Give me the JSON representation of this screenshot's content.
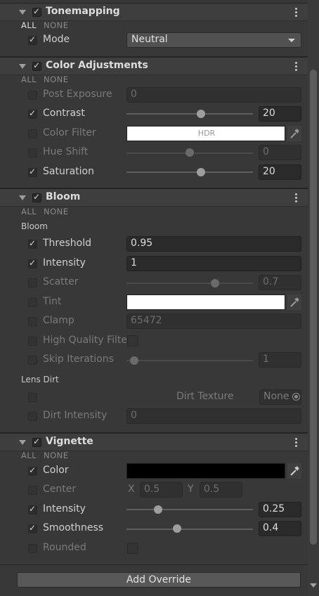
{
  "tonemapping": {
    "title": "Tonemapping",
    "all": "ALL",
    "none": "NONE",
    "mode_label": "Mode",
    "mode_value": "Neutral"
  },
  "color_adjustments": {
    "title": "Color Adjustments",
    "all": "ALL",
    "none": "NONE",
    "post_exposure_label": "Post Exposure",
    "post_exposure_value": "0",
    "contrast_label": "Contrast",
    "contrast_value": "20",
    "contrast_slider": 0.59,
    "color_filter_label": "Color Filter",
    "color_filter_hdr": "HDR",
    "color_filter_color": "#ffffff",
    "hue_shift_label": "Hue Shift",
    "hue_shift_value": "0",
    "hue_shift_slider": 0.5,
    "saturation_label": "Saturation",
    "saturation_value": "20",
    "saturation_slider": 0.59
  },
  "bloom": {
    "title": "Bloom",
    "all": "ALL",
    "none": "NONE",
    "section_bloom": "Bloom",
    "threshold_label": "Threshold",
    "threshold_value": "0.95",
    "intensity_label": "Intensity",
    "intensity_value": "1",
    "scatter_label": "Scatter",
    "scatter_value": "0.7",
    "scatter_slider": 0.7,
    "tint_label": "Tint",
    "tint_color": "#ffffff",
    "clamp_label": "Clamp",
    "clamp_value": "65472",
    "hq_filter_label": "High Quality Filte",
    "skip_iterations_label": "Skip Iterations",
    "skip_iterations_value": "1",
    "skip_iterations_slider": 0.06,
    "section_lens_dirt": "Lens Dirt",
    "dirt_texture_label": "Dirt Texture",
    "dirt_texture_value": "None",
    "dirt_intensity_label": "Dirt Intensity",
    "dirt_intensity_value": "0"
  },
  "vignette": {
    "title": "Vignette",
    "all": "ALL",
    "none": "NONE",
    "color_label": "Color",
    "color_value": "#000000",
    "center_label": "Center",
    "center_x_label": "X",
    "center_x_value": "0.5",
    "center_y_label": "Y",
    "center_y_value": "0.5",
    "intensity_label": "Intensity",
    "intensity_value": "0.25",
    "intensity_slider": 0.25,
    "smoothness_label": "Smoothness",
    "smoothness_value": "0.4",
    "smoothness_slider": 0.4,
    "rounded_label": "Rounded"
  },
  "footer": {
    "add_override_label": "Add Override"
  }
}
